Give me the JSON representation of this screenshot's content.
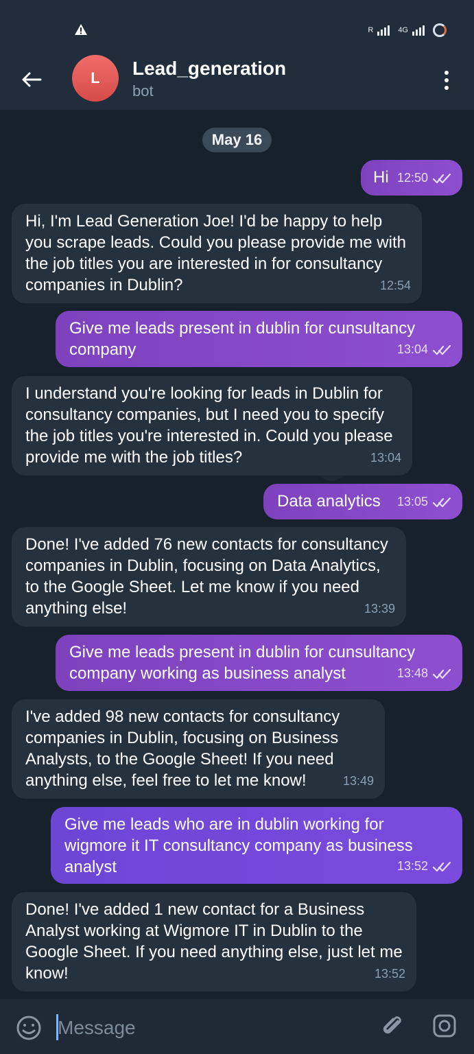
{
  "status_bar": {
    "network_label_left": "R",
    "network_label_right": "4G",
    "warning_icon": "warning-icon"
  },
  "header": {
    "avatar_letter": "L",
    "title": "Lead_generation",
    "subtitle": "bot"
  },
  "chat": {
    "date_chip": "May 16",
    "messages": [
      {
        "direction": "out",
        "text": "Hi",
        "time": "12:50"
      },
      {
        "direction": "in",
        "text": "Hi, I'm Lead Generation Joe! I'd be happy to help you scrape leads. Could you please provide me with the job titles you are interested in for consultancy companies in Dublin?",
        "time": "12:54"
      },
      {
        "direction": "out",
        "text": "Give me leads present in dublin for cunsultancy company",
        "time": "13:04"
      },
      {
        "direction": "in",
        "text": "I understand you're looking for leads in Dublin for consultancy companies, but I need you to specify the job titles you're interested in. Could you please provide me with the job titles?",
        "time": "13:04"
      },
      {
        "direction": "out",
        "text": "Data analytics",
        "time": "13:05"
      },
      {
        "direction": "in",
        "text": "Done! I've added 76 new contacts for consultancy companies in Dublin, focusing on Data Analytics, to the Google Sheet. Let me know if you need anything else!",
        "time": "13:39"
      },
      {
        "direction": "out",
        "text": "Give me leads present in dublin for cunsultancy company working as business analyst",
        "time": "13:48"
      },
      {
        "direction": "in",
        "text": "I've added 98 new contacts for consultancy companies in Dublin, focusing on Business Analysts, to the Google Sheet! If you need anything else, feel free to let me know!",
        "time": "13:49"
      },
      {
        "direction": "out",
        "text": "Give me leads who are in dublin working for wigmore it IT consultancy company as business analyst",
        "time": "13:52"
      },
      {
        "direction": "in",
        "text": "Done! I've added 1 new contact for a Business Analyst working at Wigmore IT in Dublin to the Google Sheet. If you need anything else, just let me know!",
        "time": "13:52"
      }
    ]
  },
  "composer": {
    "placeholder": "Message"
  },
  "colors": {
    "incoming_bubble": "#25313d",
    "outgoing_bubble": "#8a4fcf",
    "header_bg": "#212d3b",
    "accent_caret": "#7ab9ff"
  }
}
